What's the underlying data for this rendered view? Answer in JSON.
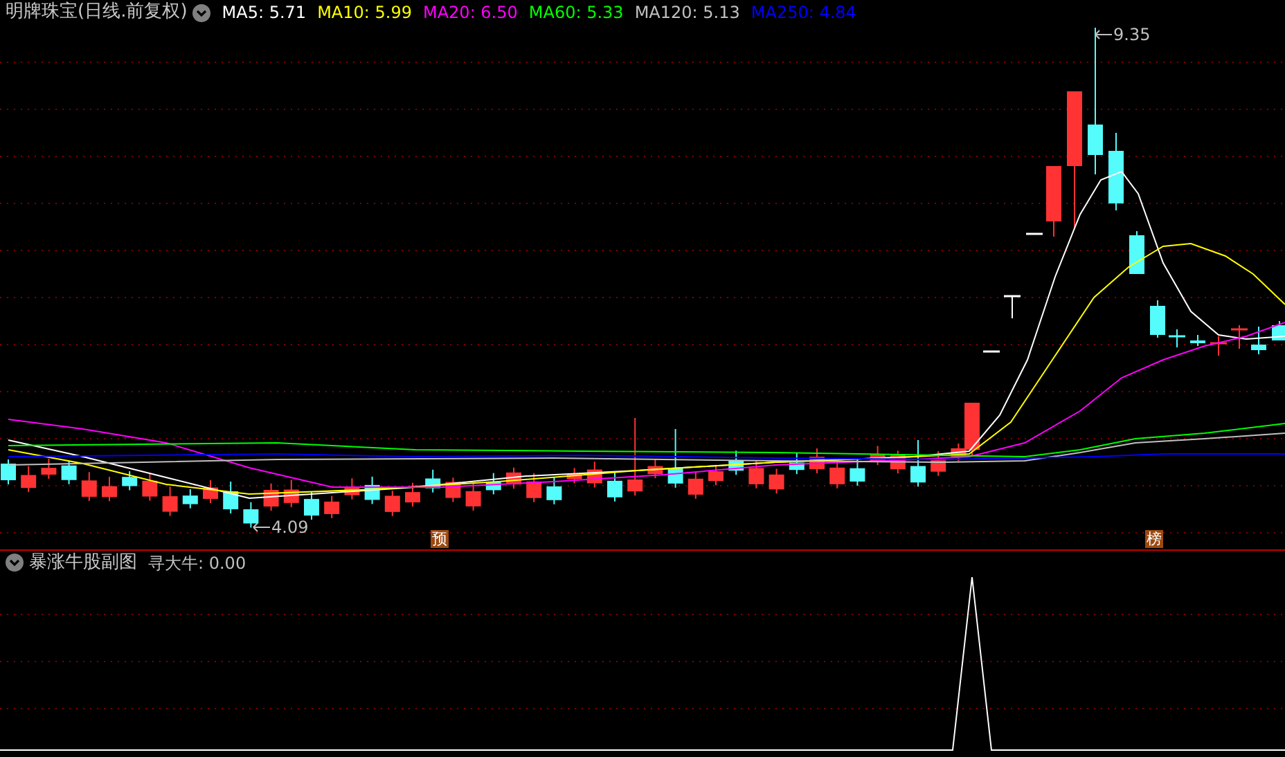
{
  "main_panel": {
    "title": "明牌珠宝(日线.前复权)",
    "indicators": [
      {
        "label": "MA5:",
        "value": "5.71",
        "color": "#ffffff"
      },
      {
        "label": "MA10:",
        "value": "5.99",
        "color": "#ffff00"
      },
      {
        "label": "MA20:",
        "value": "6.50",
        "color": "#ff00ff"
      },
      {
        "label": "MA60:",
        "value": "5.33",
        "color": "#00ff00"
      },
      {
        "label": "MA120:",
        "value": "5.13",
        "color": "#c0c0c0"
      },
      {
        "label": "MA250:",
        "value": "4.84",
        "color": "#0000ff"
      }
    ],
    "price_labels": [
      {
        "kind": "high",
        "text": "9.35"
      },
      {
        "kind": "low",
        "text": "4.09"
      }
    ],
    "markers": [
      "预",
      "榜"
    ]
  },
  "sub_panel": {
    "title": "暴涨牛股副图",
    "indicators": [
      {
        "label": "寻大牛:",
        "value": "0.00"
      }
    ]
  }
}
